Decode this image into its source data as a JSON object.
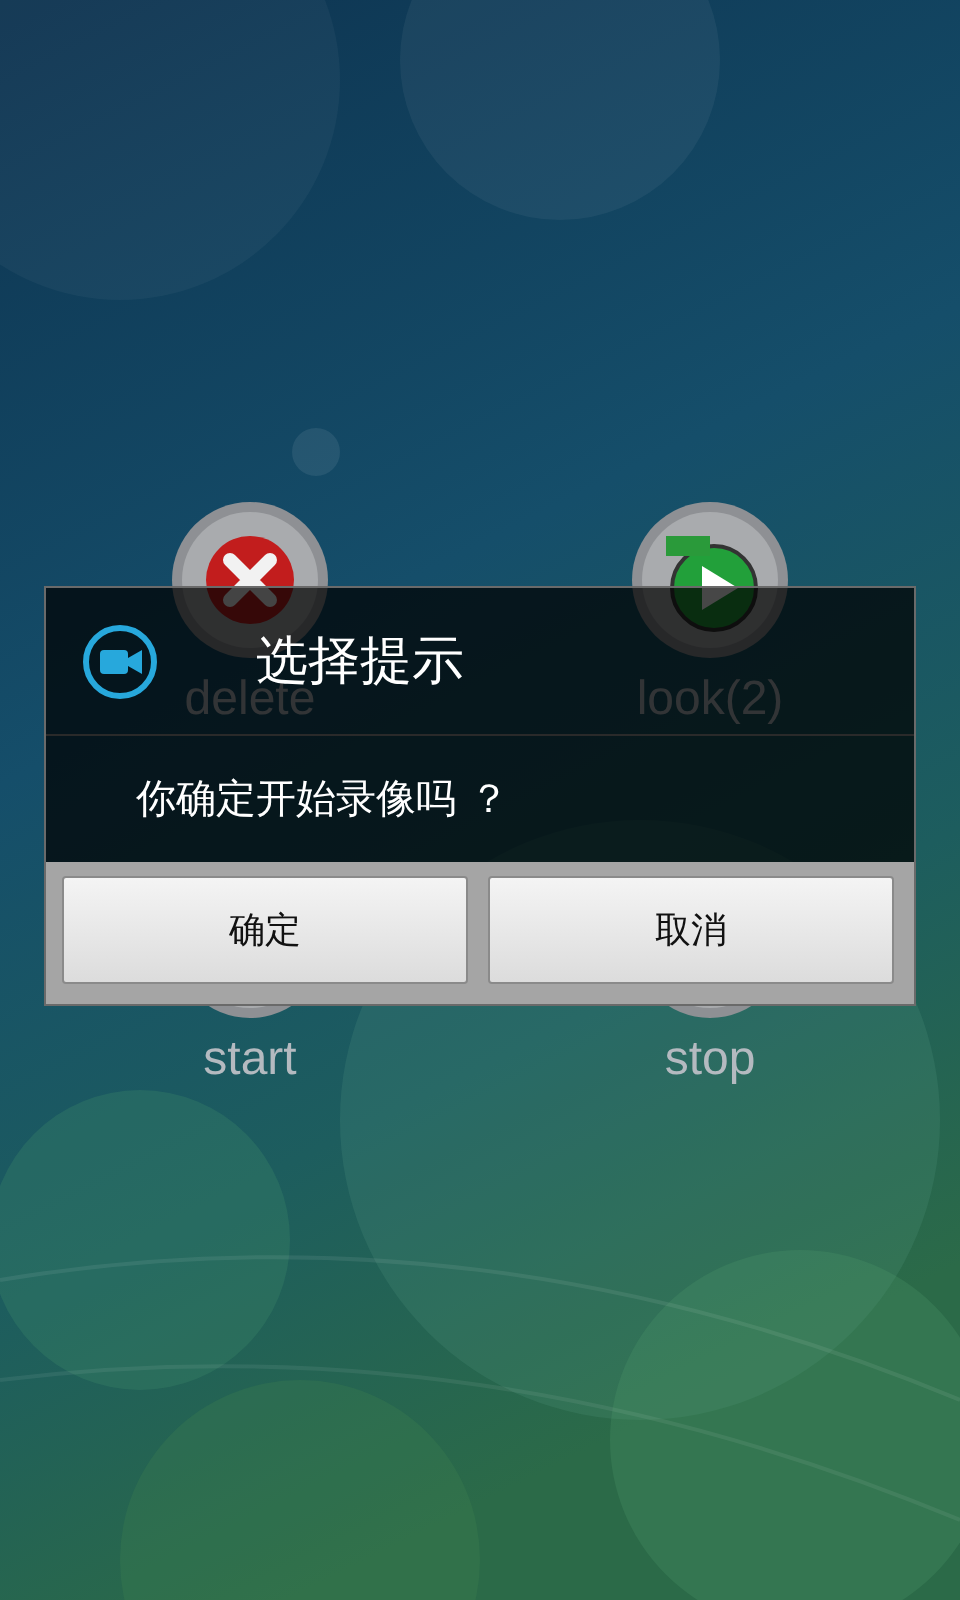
{
  "launcher": {
    "items": [
      {
        "kind": "delete",
        "label": "delete"
      },
      {
        "kind": "video",
        "label": "look(2)"
      },
      {
        "kind": "start",
        "label": "start"
      },
      {
        "kind": "stop",
        "label": "stop"
      }
    ]
  },
  "dialog": {
    "title": "选择提示",
    "message": "你确定开始录像吗 ？",
    "buttons": [
      "确定",
      "取消"
    ]
  }
}
